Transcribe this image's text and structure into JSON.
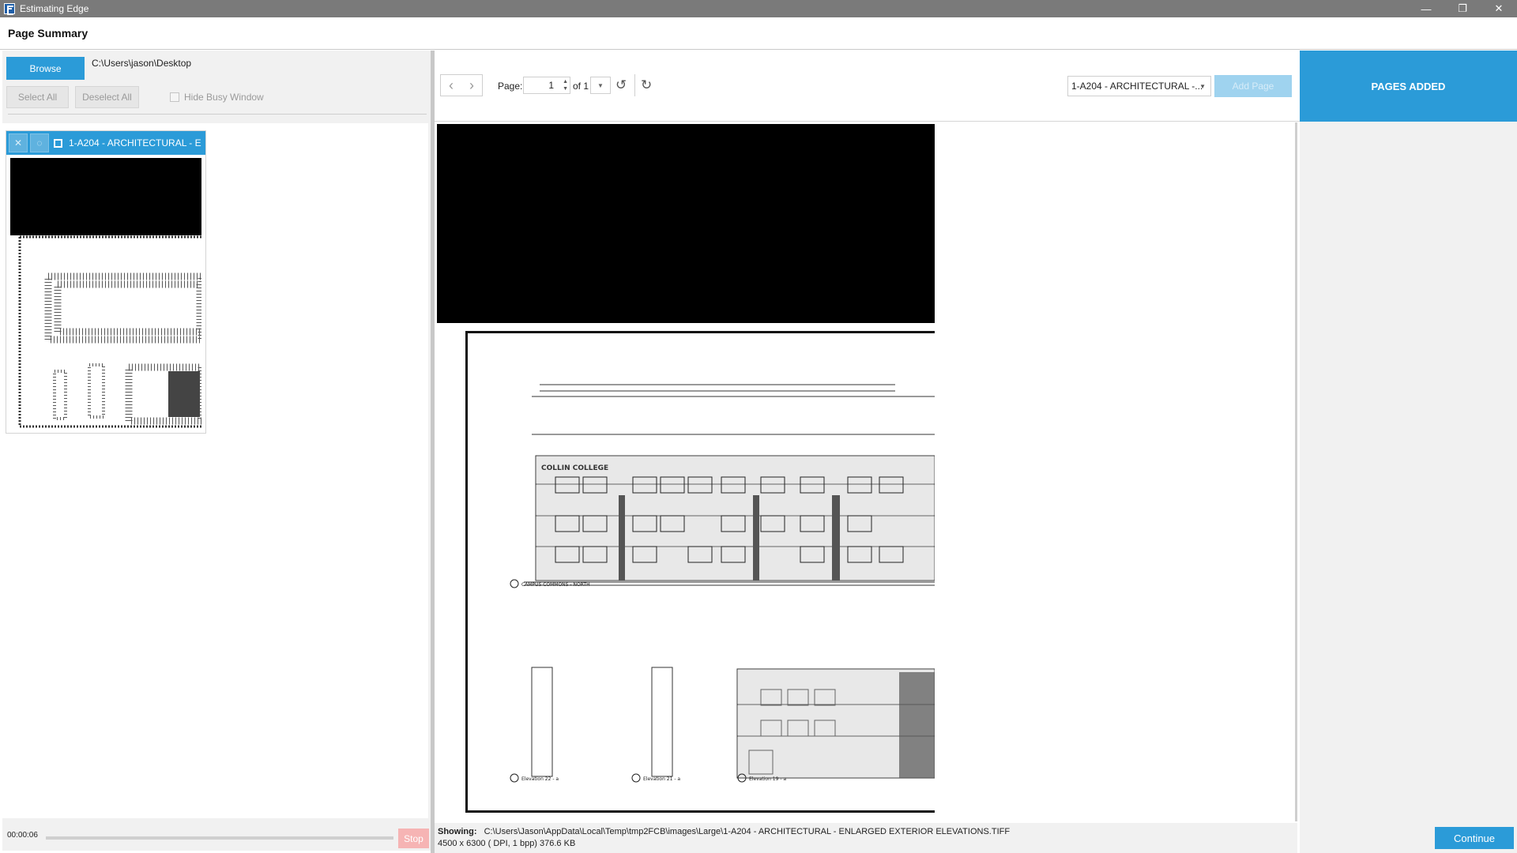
{
  "window": {
    "title": "Estimating Edge",
    "minimize": "—",
    "restore": "❐",
    "close": "✕"
  },
  "header": {
    "title": "Page Summary"
  },
  "left": {
    "browse_label": "Browse",
    "path": "C:\\Users\\jason\\Desktop",
    "select_all": "Select All",
    "deselect_all": "Deselect All",
    "hide_busy_window": "Hide Busy Window",
    "thumbnail": {
      "label": "1-A204 - ARCHITECTURAL - ENLARGED EXTERIOR ELEVATIONS"
    },
    "status": {
      "elapsed": "00:00:06",
      "stop_label": "Stop",
      "progress": 0
    }
  },
  "toolbar": {
    "prev_icon": "chevron-left-icon",
    "next_icon": "chevron-right-icon",
    "page_label": "Page:",
    "page_value": "1",
    "of_label": "of 1",
    "document_select": "1-A204 - ARCHITECTURAL -...",
    "add_page_label": "Add Page"
  },
  "viewer": {
    "showing_label": "Showing:",
    "showing_path": "C:\\Users\\Jason\\AppData\\Local\\Temp\\tmp2FCB\\images\\Large\\1-A204 - ARCHITECTURAL - ENLARGED EXTERIOR ELEVATIONS.TIFF",
    "image_info": "4500  x  6300  (   DPI,  1 bpp)  376.6 KB",
    "drawing": {
      "brand": "COLLIN COLLEGE",
      "elevation_main": "CAMPUS COMMONS - NORTH",
      "elevation_1": "Elevation 22 - a",
      "elevation_2": "Elevation 21 - a",
      "elevation_3": "Elevation 19 - a"
    }
  },
  "right": {
    "pages_added": "PAGES ADDED",
    "continue_label": "Continue"
  }
}
